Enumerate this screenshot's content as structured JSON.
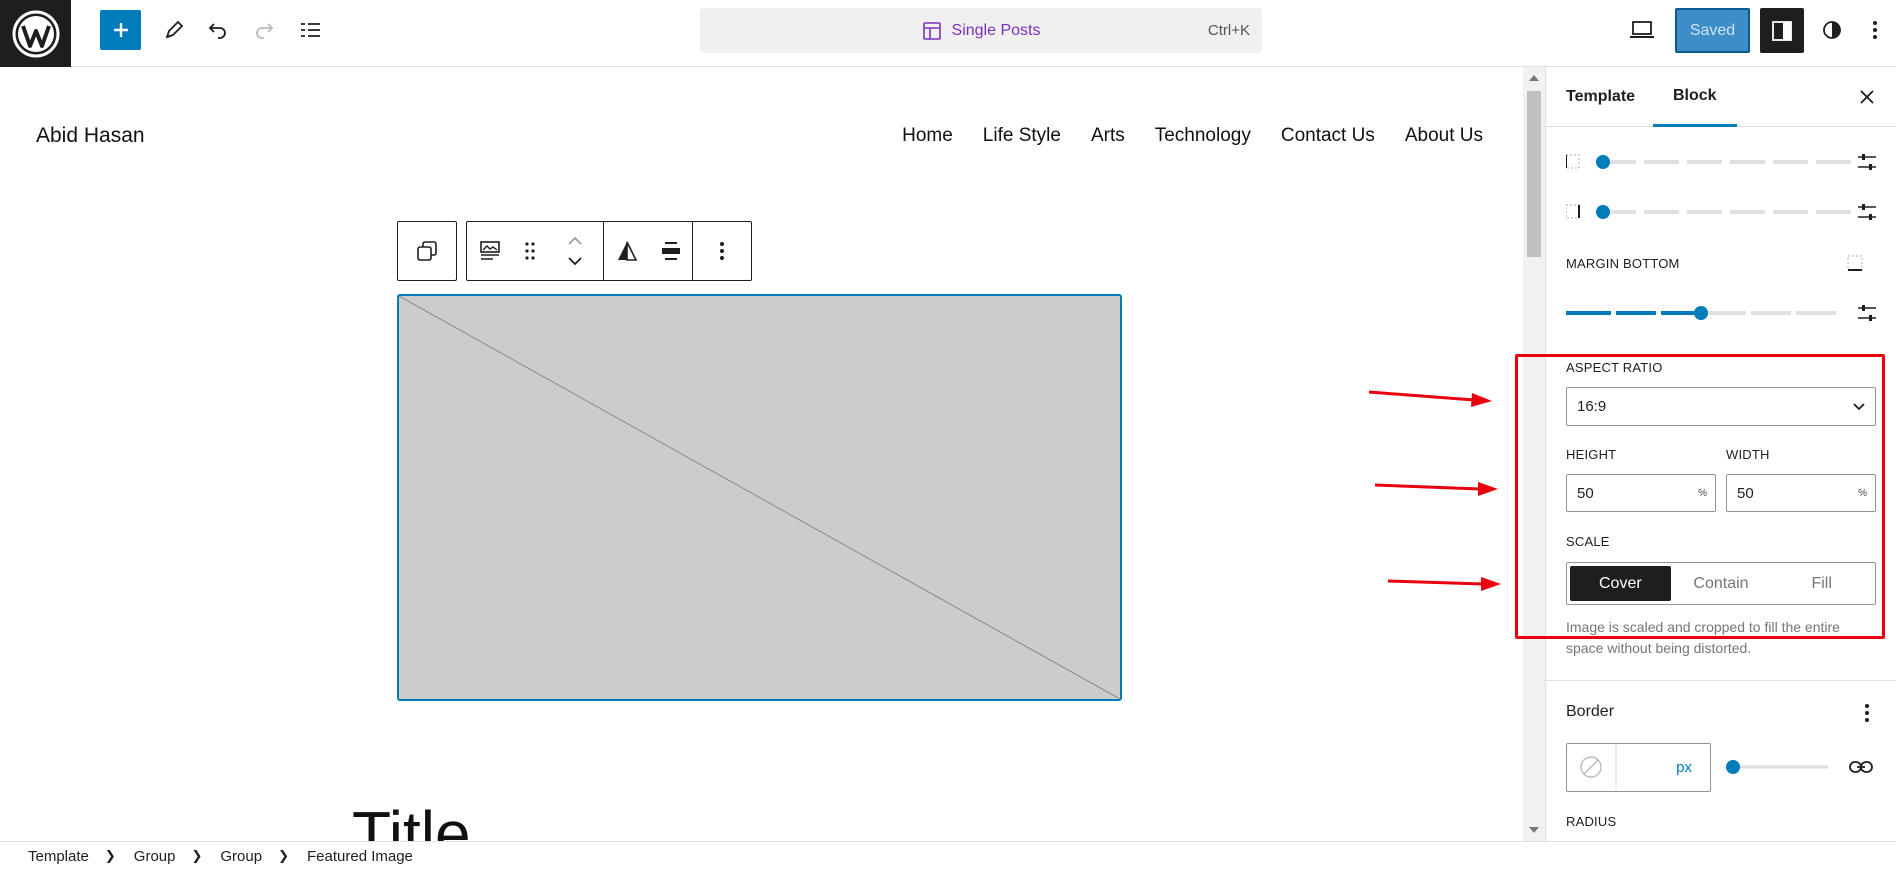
{
  "topbar": {
    "command_title": "Single Posts",
    "command_shortcut": "Ctrl+K",
    "saved_label": "Saved"
  },
  "site": {
    "title": "Abid Hasan",
    "nav": [
      "Home",
      "Life Style",
      "Arts",
      "Technology",
      "Contact Us",
      "About Us"
    ],
    "post_title": "Title"
  },
  "sidebar": {
    "tabs": [
      "Template",
      "Block"
    ],
    "active_tab": "Block",
    "margin_bottom_label": "MARGIN BOTTOM",
    "aspect_ratio_label": "ASPECT RATIO",
    "aspect_ratio_value": "16:9",
    "height_label": "HEIGHT",
    "height_value": "50",
    "height_unit": "%",
    "width_label": "WIDTH",
    "width_value": "50",
    "width_unit": "%",
    "scale_label": "SCALE",
    "scale_options": [
      "Cover",
      "Contain",
      "Fill"
    ],
    "scale_selected": "Cover",
    "scale_help": "Image is scaled and cropped to fill the entire space without being distorted.",
    "border_title": "Border",
    "border_unit": "px",
    "radius_label": "RADIUS"
  },
  "breadcrumb": [
    "Template",
    "Group",
    "Group",
    "Featured Image"
  ],
  "colors": {
    "accent": "#007cba",
    "dark": "#1e1e1e",
    "annotation_red": "#e8000f",
    "placeholder_gray": "#cccccc",
    "command_purple": "#7b2fbe"
  }
}
